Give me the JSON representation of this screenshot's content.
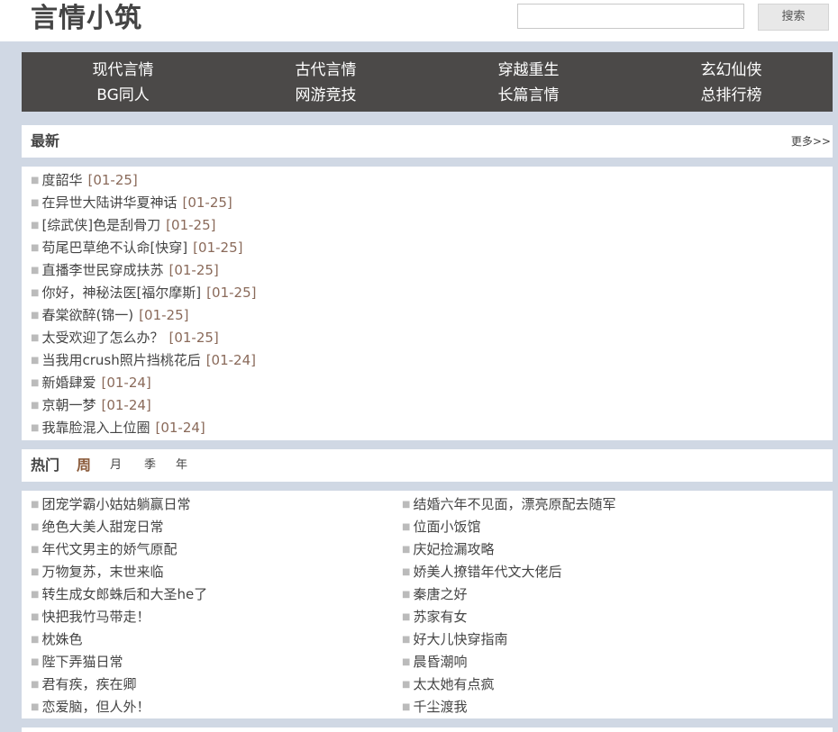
{
  "header": {
    "logo": "言情小筑",
    "search_placeholder": "",
    "search_button": "搜索"
  },
  "nav": {
    "row1": [
      "现代言情",
      "古代言情",
      "穿越重生",
      "玄幻仙侠"
    ],
    "row2": [
      "BG同人",
      "网游竞技",
      "长篇言情",
      "总排行榜"
    ]
  },
  "latest": {
    "title": "最新",
    "more": "更多>>",
    "items": [
      {
        "title": "度韶华",
        "date": "[01-25]"
      },
      {
        "title": "在异世大陆讲华夏神话",
        "date": "[01-25]"
      },
      {
        "title": "[综武侠]色是刮骨刀",
        "date": "[01-25]"
      },
      {
        "title": "苟尾巴草绝不认命[快穿]",
        "date": "[01-25]"
      },
      {
        "title": "直播李世民穿成扶苏",
        "date": "[01-25]"
      },
      {
        "title": "你好，神秘法医[福尔摩斯]",
        "date": "[01-25]"
      },
      {
        "title": "春棠欲醉(锦一)",
        "date": "[01-25]"
      },
      {
        "title": "太受欢迎了怎么办？",
        "date": "[01-25]"
      },
      {
        "title": "当我用crush照片挡桃花后",
        "date": "[01-24]"
      },
      {
        "title": "新婚肆爱",
        "date": "[01-24]"
      },
      {
        "title": "京朝一梦",
        "date": "[01-24]"
      },
      {
        "title": "我靠脸混入上位圈",
        "date": "[01-24]"
      }
    ]
  },
  "hot": {
    "title": "热门",
    "tabs": [
      "周",
      "月",
      "季",
      "年"
    ],
    "active_tab": "周",
    "left": [
      "团宠学霸小姑姑躺赢日常",
      "绝色大美人甜宠日常",
      "年代文男主的娇气原配",
      "万物复苏，末世来临",
      "转生成女郎蛛后和大圣he了",
      "快把我竹马带走！",
      "枕姝色",
      "陛下弄猫日常",
      "君有疾，疾在卿",
      "恋爱脑，但人外！"
    ],
    "right": [
      "结婚六年不见面，漂亮原配去随军",
      "位面小饭馆",
      "庆妃捡漏攻略",
      "娇美人撩错年代文大佬后",
      "秦唐之好",
      "苏家有女",
      "好大儿快穿指南",
      "晨昏潮响",
      "太太她有点疯",
      "千尘渡我"
    ]
  },
  "colors": {
    "background": "#d0d8e4",
    "nav_bg": "#4b4948",
    "date": "#8a6a5a",
    "active_tab": "#8a5a3a"
  }
}
